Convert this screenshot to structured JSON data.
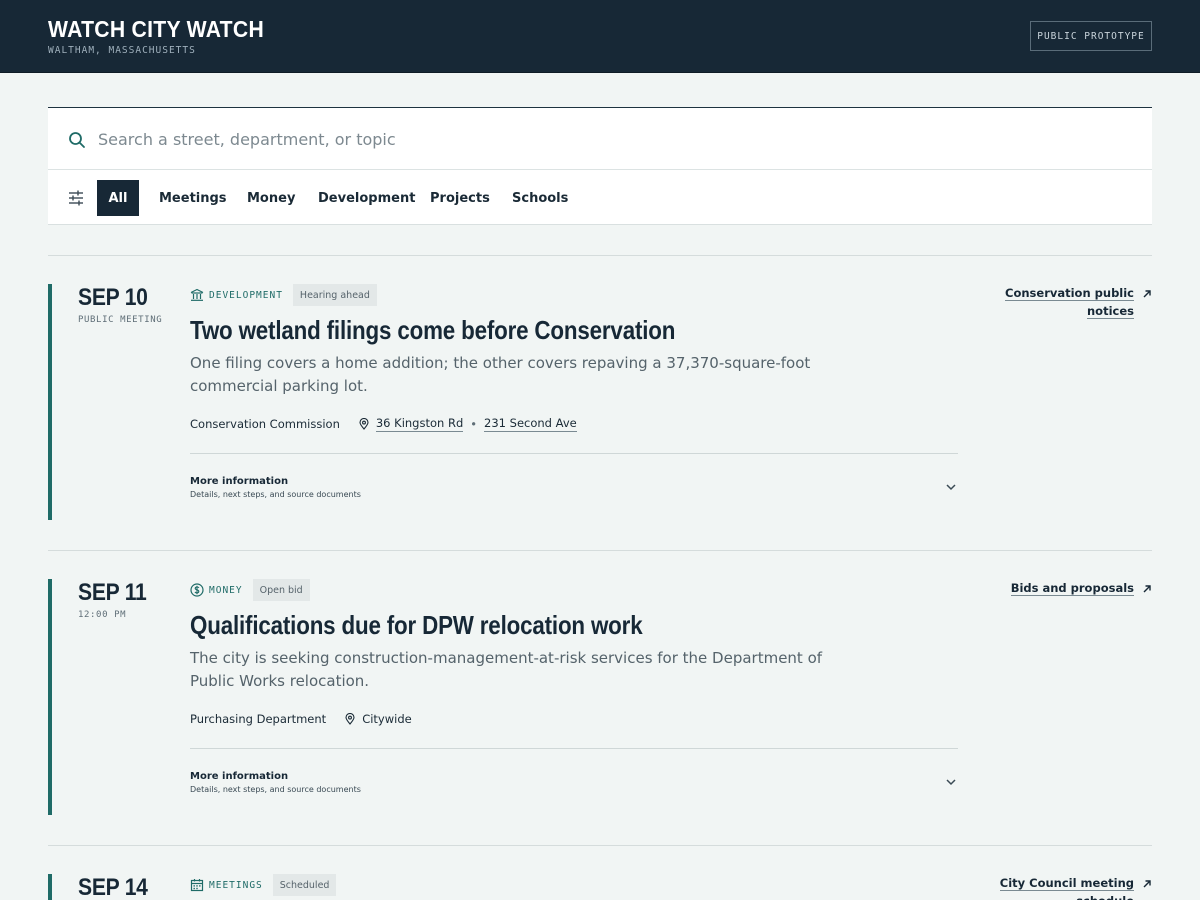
{
  "header": {
    "title": "WATCH CITY WATCH",
    "subtitle": "WALTHAM, MASSACHUSETTS",
    "badge": "PUBLIC PROTOTYPE"
  },
  "search": {
    "placeholder": "Search a street, department, or topic",
    "value": ""
  },
  "filters": [
    {
      "label": "All",
      "active": true
    },
    {
      "label": "Meetings",
      "active": false
    },
    {
      "label": "Money",
      "active": false
    },
    {
      "label": "Development",
      "active": false
    },
    {
      "label": "Projects",
      "active": false
    },
    {
      "label": "Schools",
      "active": false
    }
  ],
  "colors": {
    "header_bg": "#172836",
    "accent": "#1f6b67",
    "page_bg": "#f1f5f4"
  },
  "items": [
    {
      "date": "SEP 10",
      "date_sub": "PUBLIC MEETING",
      "category": "DEVELOPMENT",
      "category_icon": "building-icon",
      "status": "Hearing ahead",
      "title": "Two wetland filings come before Conservation",
      "summary": "One filing covers a home addition; the other covers repaving a 37,370-square-foot commercial parking lot.",
      "department": "Conservation Commission",
      "locations": [
        "36 Kingston Rd",
        "231 Second Ave"
      ],
      "more_title": "More information",
      "more_sub": "Details, next steps, and source documents",
      "link_lines": [
        "Conservation public",
        "notices"
      ]
    },
    {
      "date": "SEP 11",
      "date_sub": "12:00 PM",
      "category": "MONEY",
      "category_icon": "dollar-icon",
      "status": "Open bid",
      "title": "Qualifications due for DPW relocation work",
      "summary": "The city is seeking construction-management-at-risk services for the Department of Public Works relocation.",
      "department": "Purchasing Department",
      "location_plain": "Citywide",
      "more_title": "More information",
      "more_sub": "Details, next steps, and source documents",
      "link_lines": [
        "Bids and proposals"
      ]
    },
    {
      "date": "SEP 14",
      "category": "MEETINGS",
      "category_icon": "calendar-icon",
      "status": "Scheduled",
      "link_lines": [
        "City Council meeting",
        "schedule"
      ]
    }
  ]
}
